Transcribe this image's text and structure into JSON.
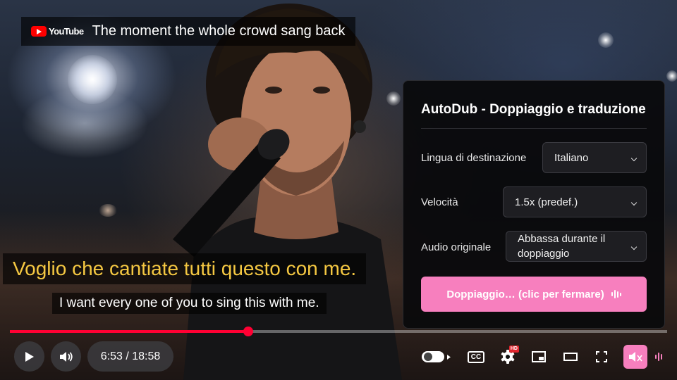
{
  "player": {
    "brand": "YouTube",
    "title": "The moment the whole crowd sang back",
    "time_display": "6:53 / 18:58",
    "progress_fraction": 0.3626,
    "colors": {
      "progress": "#ff0033",
      "accent": "#f77fbe",
      "subtitle": "#f5c842"
    }
  },
  "subtitles": {
    "translated": "Voglio che cantiate tutti questo con me.",
    "original": "I want every one of you to sing this with me."
  },
  "panel": {
    "title": "AutoDub - Doppiaggio e traduzione",
    "rows": [
      {
        "label": "Lingua di destinazione",
        "value": "Italiano"
      },
      {
        "label": "Velocità",
        "value": "1.5x (predef.)"
      },
      {
        "label": "Audio originale",
        "value": "Abbassa durante il doppiaggio"
      }
    ],
    "action_label": "Doppiaggio… (clic per fermare)"
  },
  "controls": {
    "cc_label": "CC",
    "hd_label": "HD",
    "icons": [
      "play-icon",
      "volume-icon",
      "autoplay-toggle",
      "captions-icon",
      "settings-icon",
      "miniplayer-icon",
      "theater-icon",
      "fullscreen-icon",
      "autodub-icon",
      "audio-bars-icon"
    ]
  }
}
